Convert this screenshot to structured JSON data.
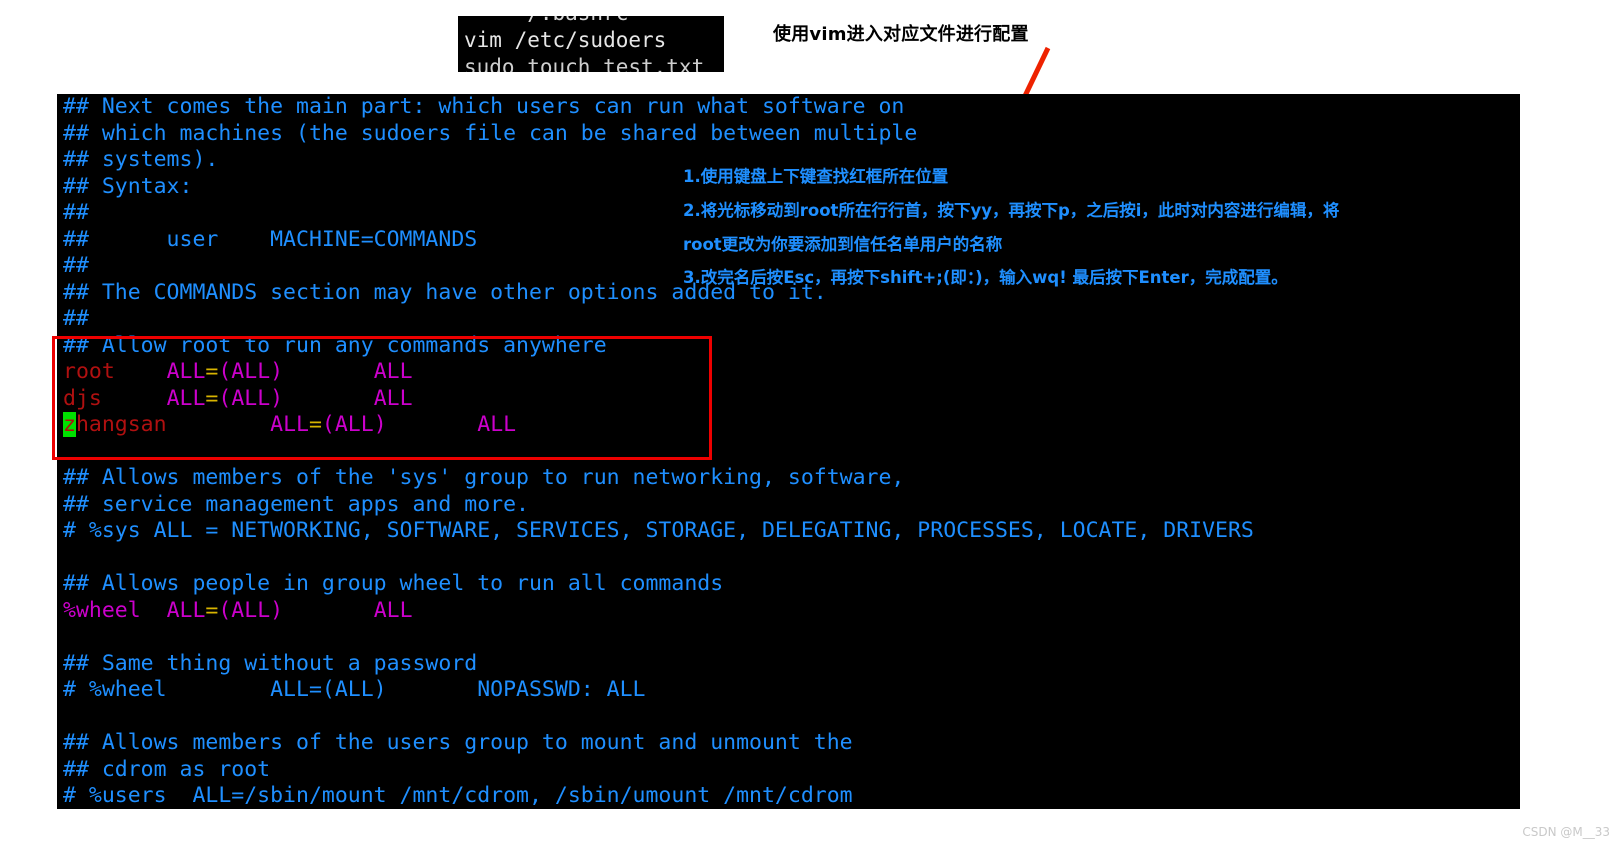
{
  "command_strip": {
    "ghost_top": "    ~/.bashrc",
    "command": "vim /etc/sudoers",
    "ghost_bottom": "sudo touch test.txt"
  },
  "annotations": {
    "title": "使用vim进入对应文件进行配置",
    "step1": "1.使用键盘上下键查找红框所在位置",
    "step2": "2.将光标移动到root所在行行首，按下yy，再按下p，之后按i，此时对内容进行编辑，将",
    "step2_cont": "root更改为你要添加到信任名单用户的名称",
    "step3": "3.改完名后按Esc，再按下shift+;(即：)，输入wq! 最后按下Enter，完成配置。"
  },
  "colors": {
    "comment": "#1f8fff",
    "user": "#b01010",
    "special": "#cc00cc",
    "equals": "#d8b400",
    "cursor_bg": "#00e000",
    "highlight_box": "#ee0000",
    "arrow": "#ee2200",
    "terminal_bg": "#000000"
  },
  "terminal": {
    "lines": [
      {
        "id": "l01",
        "text": "## Next comes the main part: which users can run what software on"
      },
      {
        "id": "l02",
        "text": "## which machines (the sudoers file can be shared between multiple"
      },
      {
        "id": "l03",
        "text": "## systems)."
      },
      {
        "id": "l04",
        "text": "## Syntax:"
      },
      {
        "id": "l05",
        "text": "##"
      },
      {
        "id": "l06",
        "text": "##      user    MACHINE=COMMANDS"
      },
      {
        "id": "l07",
        "text": "##"
      },
      {
        "id": "l08",
        "text": "## The COMMANDS section may have other options added to it."
      },
      {
        "id": "l09",
        "text": "##"
      },
      {
        "id": "l10",
        "text": "## Allow root to run any commands anywhere"
      },
      {
        "id": "l11",
        "text": "root    ALL=(ALL)       ALL"
      },
      {
        "id": "l12",
        "text": "djs     ALL=(ALL)       ALL"
      },
      {
        "id": "l13",
        "text": "zhangsan        ALL=(ALL)       ALL"
      },
      {
        "id": "l14",
        "text": ""
      },
      {
        "id": "l15",
        "text": "## Allows members of the 'sys' group to run networking, software,"
      },
      {
        "id": "l16",
        "text": "## service management apps and more."
      },
      {
        "id": "l17",
        "text": "# %sys ALL = NETWORKING, SOFTWARE, SERVICES, STORAGE, DELEGATING, PROCESSES, LOCATE, DRIVERS"
      },
      {
        "id": "l18",
        "text": ""
      },
      {
        "id": "l19",
        "text": "## Allows people in group wheel to run all commands"
      },
      {
        "id": "l20",
        "text": "%wheel  ALL=(ALL)       ALL"
      },
      {
        "id": "l21",
        "text": ""
      },
      {
        "id": "l22",
        "text": "## Same thing without a password"
      },
      {
        "id": "l23",
        "text": "# %wheel        ALL=(ALL)       NOPASSWD: ALL"
      },
      {
        "id": "l24",
        "text": ""
      },
      {
        "id": "l25",
        "text": "## Allows members of the users group to mount and unmount the"
      },
      {
        "id": "l26",
        "text": "## cdrom as root"
      },
      {
        "id": "l27",
        "text": "# %users  ALL=/sbin/mount /mnt/cdrom, /sbin/umount /mnt/cdrom"
      }
    ],
    "segments": {
      "l11": {
        "user": "root",
        "gap1": "    ",
        "all_open": "ALL",
        "eq": "=",
        "all_paren": "(ALL)",
        "gap2": "       ",
        "all_cmd": "ALL"
      },
      "l12": {
        "user": "djs",
        "gap1": "     ",
        "all_open": "ALL",
        "eq": "=",
        "all_paren": "(ALL)",
        "gap2": "       ",
        "all_cmd": "ALL"
      },
      "l13": {
        "cursor_char": "z",
        "user_rest": "hangsan",
        "gap1": "        ",
        "all_open": "ALL",
        "eq": "=",
        "all_paren": "(ALL)",
        "gap2": "       ",
        "all_cmd": "ALL"
      },
      "l20": {
        "user": "%wheel",
        "gap1": "  ",
        "all_open": "ALL",
        "eq": "=",
        "all_paren": "(ALL)",
        "gap2": "       ",
        "all_cmd": "ALL"
      }
    }
  },
  "watermark": "CSDN @M__33"
}
